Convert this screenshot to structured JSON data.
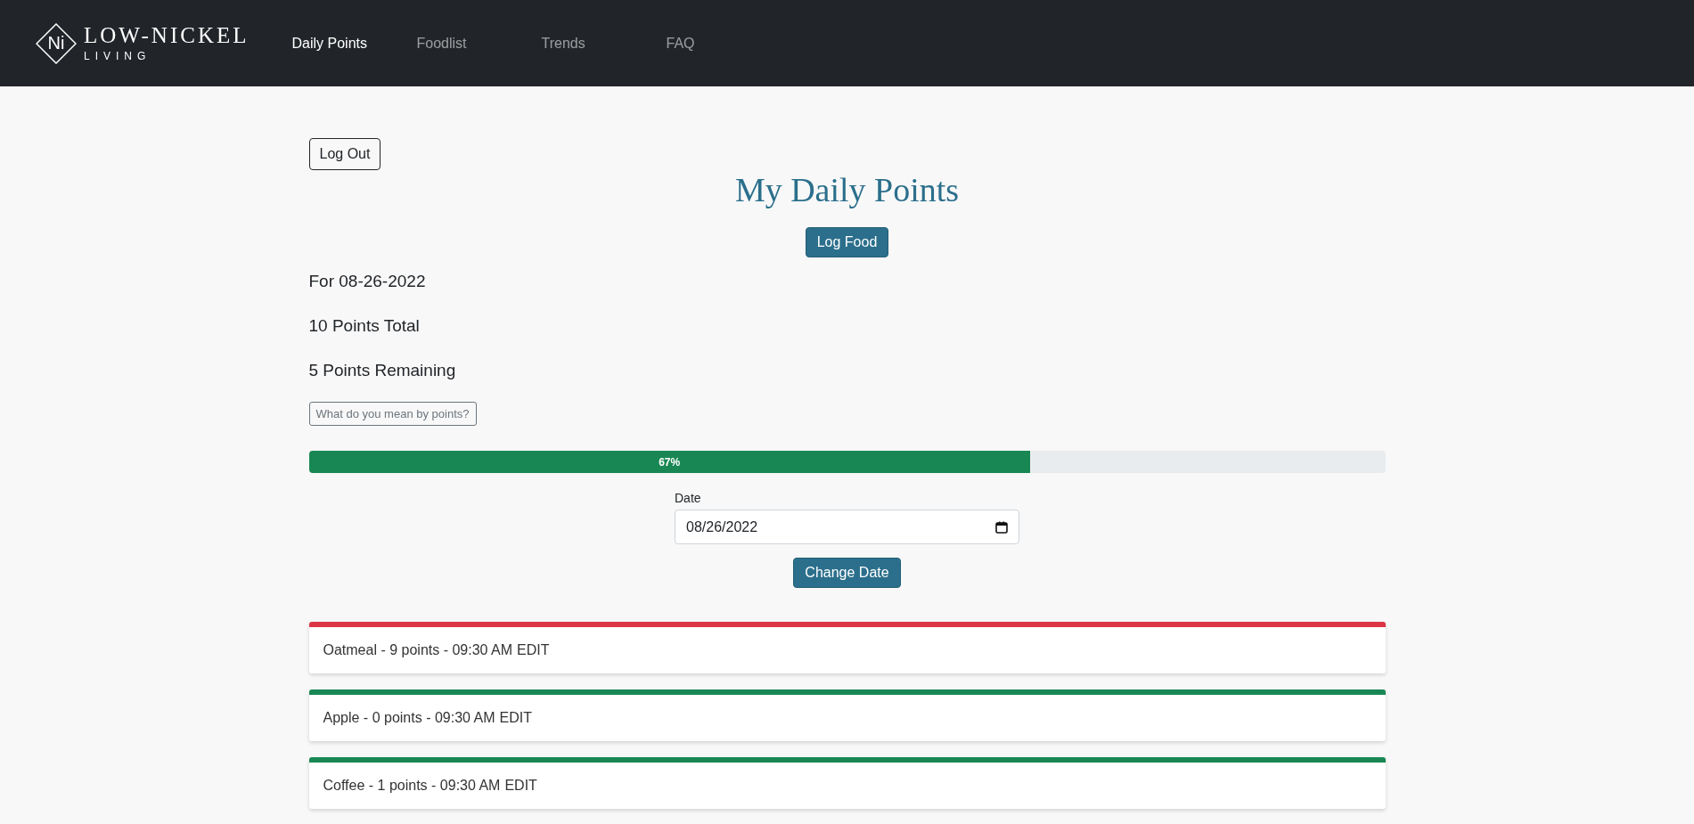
{
  "navbar": {
    "logo": {
      "mark": "Ni",
      "name": "LOW-NICKEL",
      "tagline": "LIVING"
    },
    "links": [
      {
        "label": "Daily Points",
        "selected": true
      },
      {
        "label": "Foodlist",
        "selected": false
      },
      {
        "label": "Trends",
        "selected": false
      },
      {
        "label": "FAQ",
        "selected": false
      }
    ]
  },
  "logout_button": "Log Out",
  "title": "My Daily Points",
  "log_food_button": "Log Food",
  "summary": [
    "For 08-26-2022",
    "10 Points Total",
    "5 Points Remaining"
  ],
  "points_help_button": "What do you mean by points?",
  "progress": {
    "level": 0.67,
    "label": "67%"
  },
  "date_field": {
    "label": "Date",
    "value": "08/26/2022"
  },
  "change_date_button": "Change Date",
  "entries": [
    {
      "text": "Oatmeal - 9 points - 09:30 AM",
      "edit": "EDIT",
      "color": "#dc3545"
    },
    {
      "text": "Apple - 0 points - 09:30 AM",
      "edit": "EDIT",
      "color": "#198754"
    },
    {
      "text": "Coffee - 1 points - 09:30 AM",
      "edit": "EDIT",
      "color": "#198754"
    }
  ]
}
